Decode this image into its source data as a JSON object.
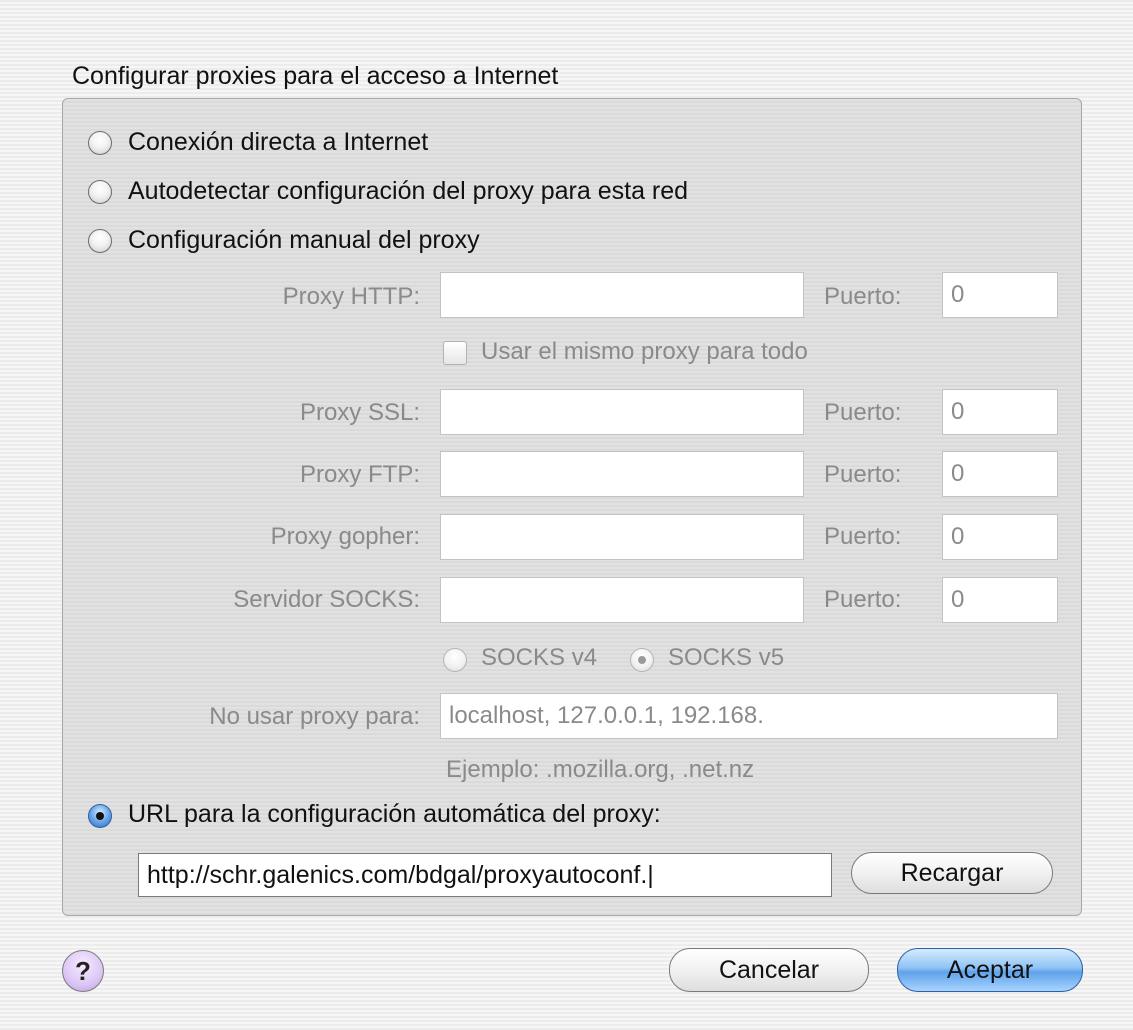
{
  "dialog": {
    "group_title": "Configurar proxies para el acceso a Internet"
  },
  "options": {
    "direct": "Conexión directa a Internet",
    "autodetect": "Autodetectar configuración del proxy para esta red",
    "manual": "Configuración manual del proxy",
    "auto_url": "URL para la configuración automática del proxy:"
  },
  "manual": {
    "http_label": "Proxy HTTP:",
    "http_value": "",
    "same_proxy_label": "Usar el mismo proxy para todo",
    "ssl_label": "Proxy SSL:",
    "ssl_value": "",
    "ftp_label": "Proxy FTP:",
    "ftp_value": "",
    "gopher_label": "Proxy gopher:",
    "gopher_value": "",
    "socks_label": "Servidor SOCKS:",
    "socks_value": "",
    "port_label": "Puerto:",
    "http_port": "0",
    "ssl_port": "0",
    "ftp_port": "0",
    "gopher_port": "0",
    "socks_port": "0",
    "socks_v4": "SOCKS v4",
    "socks_v5": "SOCKS v5",
    "no_proxy_label": "No usar proxy para:",
    "no_proxy_value": "localhost, 127.0.0.1, 192.168.",
    "example": "Ejemplo: .mozilla.org, .net.nz"
  },
  "auto": {
    "url_value": "http://schr.galenics.com/bdgal/proxyautoconf.|",
    "reload_label": "Recargar"
  },
  "footer": {
    "help": "?",
    "cancel": "Cancelar",
    "accept": "Aceptar"
  }
}
